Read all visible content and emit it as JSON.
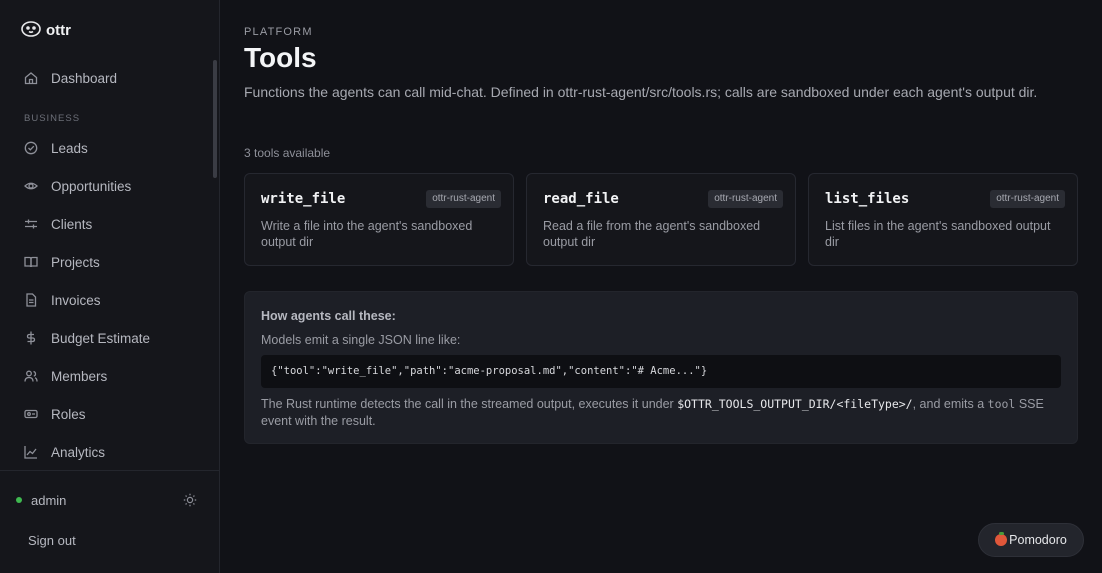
{
  "brand": {
    "name": "ottr"
  },
  "sidebar": {
    "dashboard": "Dashboard",
    "section_label": "BUSINESS",
    "items": [
      {
        "label": "Leads",
        "icon": "check-circle-icon"
      },
      {
        "label": "Opportunities",
        "icon": "eye-icon"
      },
      {
        "label": "Clients",
        "icon": "sliders-icon"
      },
      {
        "label": "Projects",
        "icon": "book-icon"
      },
      {
        "label": "Invoices",
        "icon": "file-icon"
      },
      {
        "label": "Budget Estimate",
        "icon": "dollar-icon"
      },
      {
        "label": "Members",
        "icon": "users-icon"
      },
      {
        "label": "Roles",
        "icon": "badge-icon"
      },
      {
        "label": "Analytics",
        "icon": "chart-icon"
      }
    ],
    "user": "admin",
    "sign_out": "Sign out"
  },
  "header": {
    "eyebrow": "PLATFORM",
    "title": "Tools",
    "description": "Functions the agents can call mid-chat. Defined in ottr-rust-agent/src/tools.rs; calls are sandboxed under each agent's output dir.",
    "count": "3 tools available"
  },
  "tools": [
    {
      "name": "write_file",
      "badge": "ottr-rust-agent",
      "description": "Write a file into the agent's sandboxed output dir"
    },
    {
      "name": "read_file",
      "badge": "ottr-rust-agent",
      "description": "Read a file from the agent's sandboxed output dir"
    },
    {
      "name": "list_files",
      "badge": "ottr-rust-agent",
      "description": "List files in the agent's sandboxed output dir"
    }
  ],
  "info": {
    "title": "How agents call these:",
    "subtitle": "Models emit a single JSON line like:",
    "code": "{\"tool\":\"write_file\",\"path\":\"acme-proposal.md\",\"content\":\"# Acme...\"}",
    "foot_pre": "The Rust runtime detects the call in the streamed output, executes it under ",
    "foot_path": "$OTTR_TOOLS_OUTPUT_DIR/<fileType>/",
    "foot_mid": ", and emits a ",
    "foot_word": "tool",
    "foot_post": " SSE event with the result."
  },
  "pomodoro": {
    "label": "Pomodoro"
  },
  "colors": {
    "status_online": "#3fb950",
    "background": "#111217",
    "tomato": "#e0573a"
  }
}
